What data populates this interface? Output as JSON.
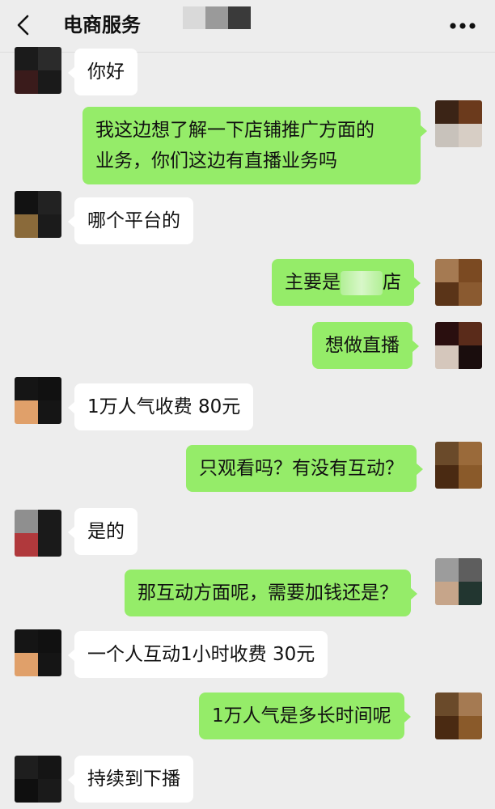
{
  "header": {
    "back_icon": "chevron-left-icon",
    "title": "电商服务",
    "more_icon": "more-dots-icon"
  },
  "messages": [
    {
      "side": "in",
      "text": "你好"
    },
    {
      "side": "out",
      "lines": [
        "我这边想了解一下店铺推广方面的",
        "业务，你们这边有直播业务吗"
      ]
    },
    {
      "side": "in",
      "text": "哪个平台的"
    },
    {
      "side": "out",
      "text_before": "主要是",
      "text_after": "店"
    },
    {
      "side": "out",
      "text": "想做直播"
    },
    {
      "side": "in",
      "text": "1万人气收费 80元"
    },
    {
      "side": "out",
      "text": "只观看吗？有没有互动？"
    },
    {
      "side": "in",
      "text": "是的"
    },
    {
      "side": "out",
      "text": "那互动方面呢，需要加钱还是？"
    },
    {
      "side": "in",
      "text": "一个人互动1小时收费 30元"
    },
    {
      "side": "out",
      "text": "1万人气是多长时间呢"
    },
    {
      "side": "in",
      "text": "持续到下播"
    }
  ],
  "colors": {
    "background": "#ededed",
    "bubble_in": "#ffffff",
    "bubble_out": "#95ec69"
  }
}
